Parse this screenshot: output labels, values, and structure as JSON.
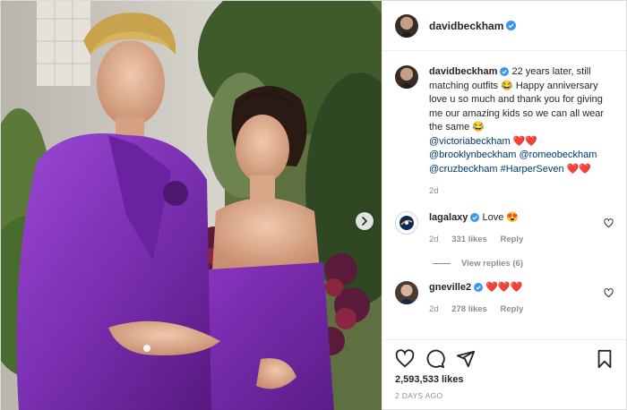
{
  "post": {
    "author": "davidbeckham",
    "image_alt": "Couple in matching purple outfits",
    "likes": "2,593,533 likes",
    "posted_ago": "2 DAYS AGO"
  },
  "caption": {
    "username": "davidbeckham",
    "text_1": "22 years later, still matching outfits ",
    "text_2": " Happy anniversary love u so much and thank you for giving me our amazing kids so we can all wear the same ",
    "mention_victoria": "@victoriabeckham",
    "mention_brooklyn": "@brooklynbeckham",
    "mention_romeo": "@romeobeckham",
    "mention_cruz": "@cruzbeckham",
    "hashtag": "#HarperSeven",
    "age": "2d"
  },
  "comments": [
    {
      "username": "lagalaxy",
      "text": "Love ",
      "age": "2d",
      "likes": "331 likes",
      "reply": "Reply"
    },
    {
      "username": "gneville2",
      "text": "",
      "age": "2d",
      "likes": "278 likes",
      "reply": "Reply"
    }
  ],
  "view_replies": "View replies (6)",
  "icons": [
    "heart-icon",
    "comment-icon",
    "share-icon",
    "bookmark-icon",
    "verified-icon",
    "next-arrow-icon"
  ],
  "colors": {
    "verified": "#3897f0",
    "link": "#00376b",
    "heart": "#ed1c24",
    "outfit": "#7b2fb1"
  }
}
